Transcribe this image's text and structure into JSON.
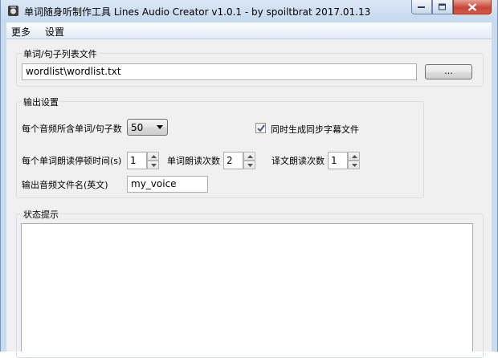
{
  "window": {
    "title": "单词随身听制作工具  Lines Audio Creator v1.0.1 - by spoiltbrat  2017.01.13"
  },
  "menu": {
    "items": [
      "更多",
      "设置"
    ]
  },
  "file_group": {
    "legend": "单词/句子列表文件",
    "path_value": "wordlist\\wordlist.txt",
    "browse_label": "..."
  },
  "output_group": {
    "legend": "输出设置",
    "words_per_file_label": "每个音频所含单词/句子数",
    "words_per_file_value": "50",
    "subtitle_label": "同时生成同步字幕文件",
    "subtitle_checked": true,
    "pause_label": "每个单词朗读停顿时间(s)",
    "pause_value": "1",
    "repeat_label": "单词朗读次数",
    "repeat_value": "2",
    "translation_label": "译文朗读次数",
    "translation_value": "1",
    "filename_label": "输出音频文件名(英文)",
    "filename_value": "my_voice"
  },
  "status_group": {
    "legend": "状态提示",
    "text": ""
  }
}
